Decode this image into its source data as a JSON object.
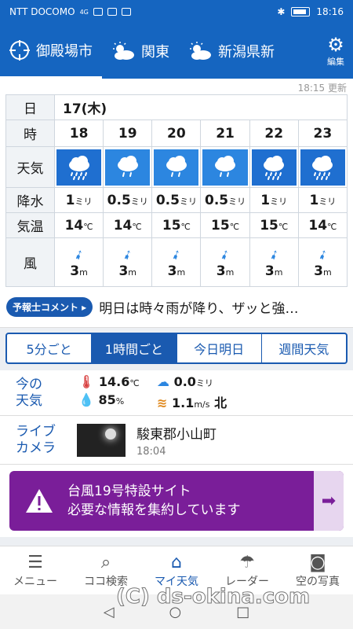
{
  "status_bar": {
    "carrier": "NTT DOCOMO",
    "network": "4G",
    "time": "18:16"
  },
  "locations": [
    {
      "label": "御殿場市",
      "icon": "target-icon"
    },
    {
      "label": "関東",
      "icon": "sun-cloud-icon"
    },
    {
      "label": "新潟県新",
      "icon": "sun-cloud-icon"
    }
  ],
  "settings_label": "編集",
  "updated": "18:15 更新",
  "forecast": {
    "row_labels": {
      "day": "日",
      "hour": "時",
      "weather": "天気",
      "precip": "降水",
      "temp": "気温",
      "wind": "風"
    },
    "day": "17(木)",
    "hours": [
      "18",
      "19",
      "20",
      "21",
      "22",
      "23"
    ],
    "weather": [
      "rain",
      "light-rain",
      "light-rain",
      "light-rain",
      "rain",
      "rain"
    ],
    "precip": [
      "1",
      "0.5",
      "0.5",
      "0.5",
      "1",
      "1"
    ],
    "precip_unit": "ミリ",
    "temp": [
      "14",
      "14",
      "15",
      "15",
      "15",
      "14"
    ],
    "temp_unit": "℃",
    "wind": [
      "3",
      "3",
      "3",
      "3",
      "3",
      "3"
    ],
    "wind_unit": "m"
  },
  "comment": {
    "badge": "予報士コメント ▸",
    "text": "明日は時々雨が降り、ザッと強…"
  },
  "tabs": [
    "5分ごと",
    "1時間ごと",
    "今日明日",
    "週間天気"
  ],
  "current": {
    "label_line1": "今の",
    "label_line2": "天気",
    "temp": "14.6",
    "temp_unit": "℃",
    "precip": "0.0",
    "precip_unit": "ミリ",
    "humidity": "85",
    "humidity_unit": "%",
    "wind": "1.1",
    "wind_unit": "m/s",
    "wind_dir": "北"
  },
  "live": {
    "label_line1": "ライブ",
    "label_line2": "カメラ",
    "place": "駿東郡小山町",
    "time": "18:04"
  },
  "banner": {
    "line1": "台風19号特設サイト",
    "line2": "必要な情報を集約しています"
  },
  "nav": [
    {
      "label": "メニュー",
      "icon": "menu-icon"
    },
    {
      "label": "ココ検索",
      "icon": "search-icon"
    },
    {
      "label": "マイ天気",
      "icon": "home-icon"
    },
    {
      "label": "レーダー",
      "icon": "umbrella-icon"
    },
    {
      "label": "空の写真",
      "icon": "camera-icon"
    }
  ],
  "watermark": "(C) ds-okina.com",
  "colors": {
    "primary": "#1565c0",
    "accent": "#2c86e0",
    "banner": "#7a1e99"
  }
}
